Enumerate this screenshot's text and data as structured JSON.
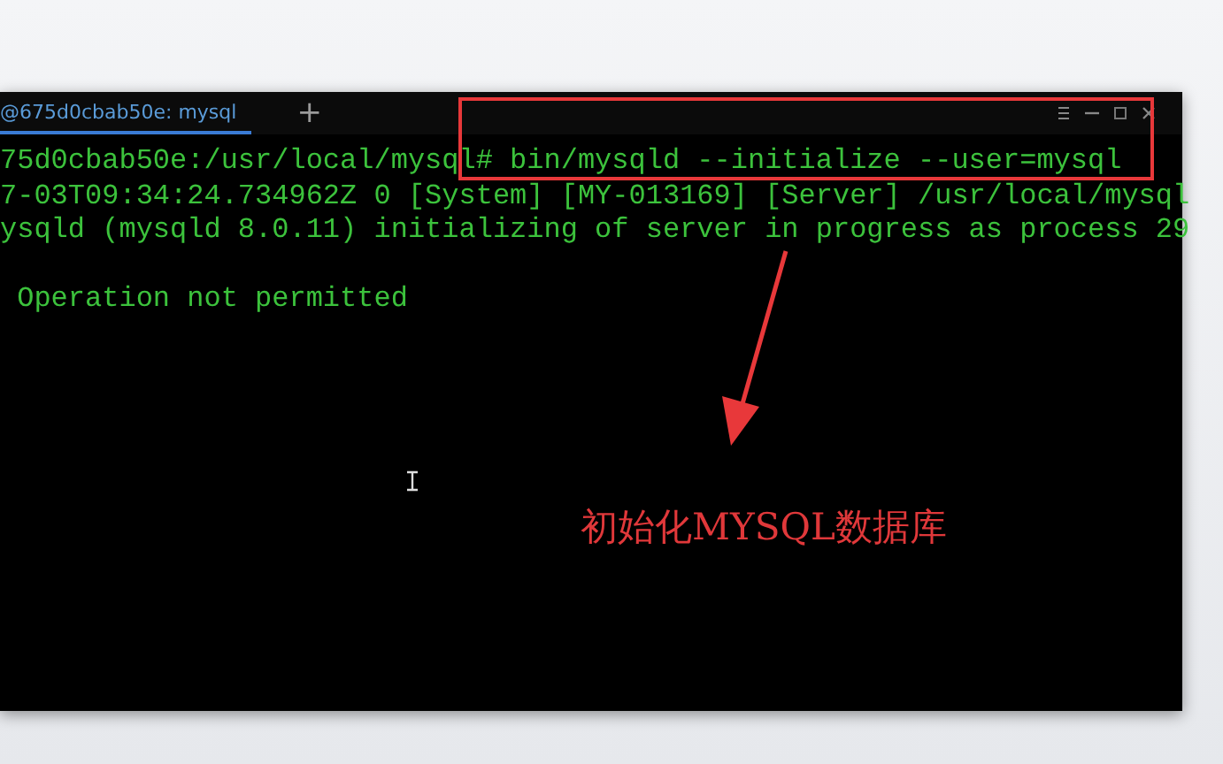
{
  "tabs": [
    {
      "label": "@675d0cbab50e: mysql",
      "selected": true
    }
  ],
  "new_tab_button": "+",
  "terminal": {
    "lines": [
      {
        "text": "75d0cbab50e:/usr/local/mysql# bin/mysqld --initialize --user=mysql",
        "blank_before": false
      },
      {
        "text": "7-03T09:34:24.734962Z 0 [System] [MY-013169] [Server] /usr/local/mysql",
        "blank_before": false
      },
      {
        "text": "ysqld (mysqld 8.0.11) initializing of server in progress as process 29",
        "blank_before": false
      },
      {
        "text": " Operation not permitted",
        "blank_before": true
      }
    ]
  },
  "annotation": {
    "label": "初始化MYSQL数据库"
  }
}
